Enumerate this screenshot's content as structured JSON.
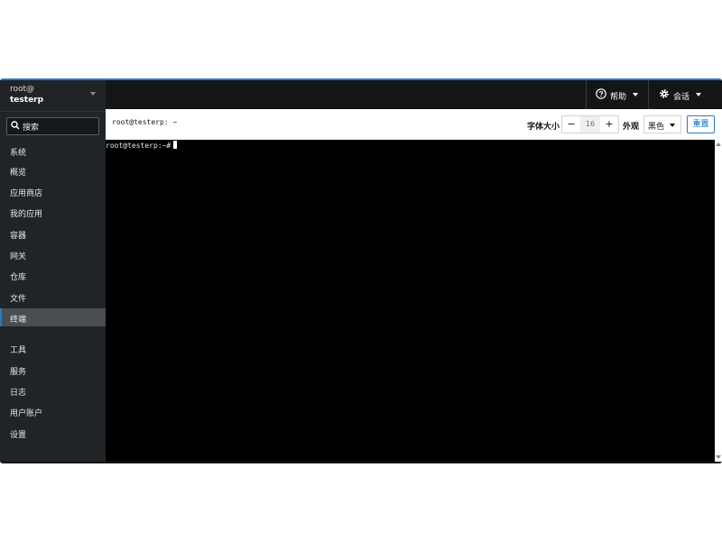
{
  "host": {
    "user": "root@",
    "name": "testerp"
  },
  "search": {
    "label": "搜索"
  },
  "nav": {
    "section_system": "系统",
    "system_items": [
      "概览",
      "应用商店",
      "我的应用",
      "容器",
      "网关",
      "仓库",
      "文件",
      "终端"
    ],
    "active": "终端",
    "section_tools": "工具",
    "tool_items": [
      "服务",
      "日志",
      "用户账户",
      "设置"
    ]
  },
  "topbar": {
    "help": "帮助",
    "session": "会话"
  },
  "toolbar": {
    "title": "root@testerp: ~",
    "font_size_label": "字体大小",
    "font_size_value": "16",
    "decrement": "−",
    "increment": "+",
    "appearance_label": "外观",
    "appearance_value": "黑色",
    "reset": "重置"
  },
  "terminal": {
    "prompt": "root@testerp:~#"
  },
  "colors": {
    "accent": "#2b78c5",
    "sidebar": "#212427",
    "topbar": "#151515",
    "terminal": "#000000"
  }
}
